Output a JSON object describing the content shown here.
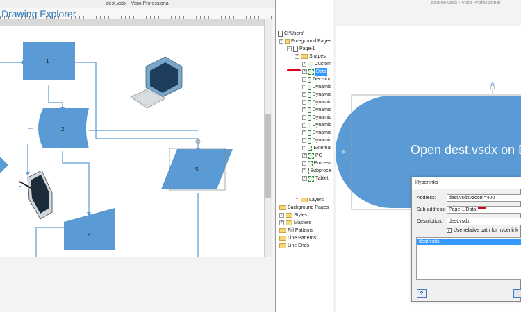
{
  "left_window": {
    "title": "dest.vsdx - Visio Professional",
    "shapes": {
      "s1": "1",
      "s2": "2",
      "s4": "4",
      "s5": "5"
    }
  },
  "explorer": {
    "title": "Drawing Explorer",
    "nodes": [
      "C:\\Users\\",
      "Foreground Pages",
      "Page-1",
      "Shapes",
      "Custom",
      "Data",
      "Decision",
      "Dynamic",
      "Dynamic",
      "Dynamic",
      "Dynamic",
      "Dynamic",
      "Dynamic",
      "Dynamic",
      "Dynamic",
      "External",
      "PC",
      "Process",
      "Subprocess",
      "Tablet",
      "Layers",
      "Background Pages",
      "Styles",
      "Masters",
      "Fill Patterns",
      "Line Patterns",
      "Line Ends"
    ]
  },
  "right_window": {
    "title": "source.vsdx - Visio Professional",
    "shape_text": "Open dest.vsdx on Data"
  },
  "hyperlinks_dialog": {
    "title": "Hyperlinks",
    "address_label": "Address:",
    "address_value": "dest.vsdx?zoom=400",
    "subaddress_label": "Sub-address:",
    "subaddress_value": "Page-1/Data",
    "description_label": "Description:",
    "description_value": "dest.vsdx",
    "relative_path_label": "Use relative path for hyperlink",
    "relative_path_checked": true,
    "list_items": [
      "dest.vsdx"
    ],
    "help_label": "?"
  },
  "colors": {
    "shape_fill": "#5b9bd5",
    "connector": "#5b9bd5",
    "accent": "#2e75b6",
    "selection": "#3399ff",
    "annotation_red": "#d9001b"
  }
}
